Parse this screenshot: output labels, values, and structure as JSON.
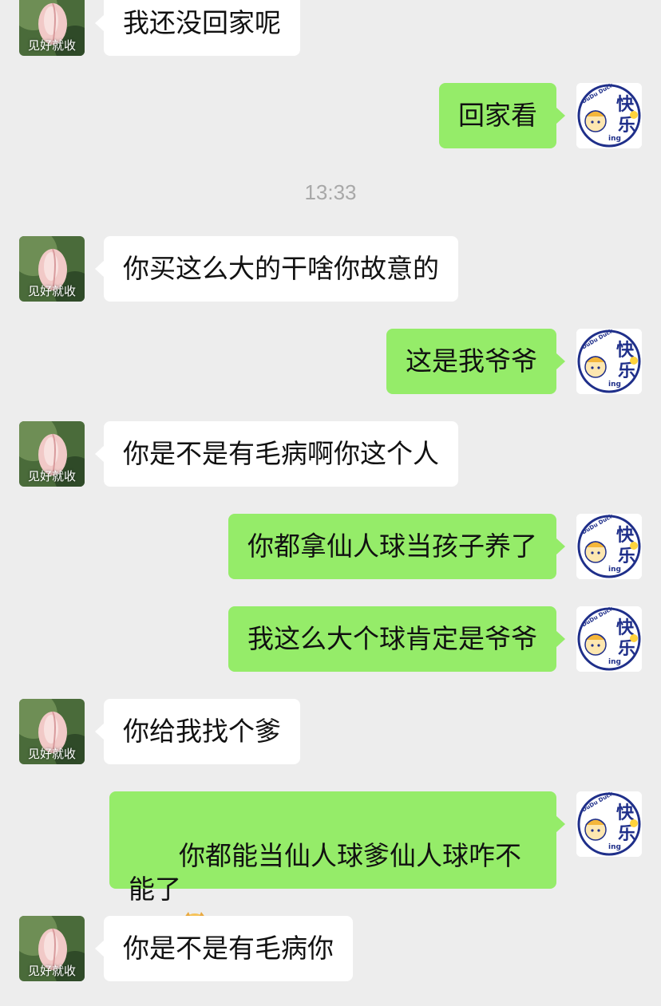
{
  "timestamp": "13:33",
  "avatars": {
    "other_label": "见好就收",
    "self_text_top": "快",
    "self_text_bottom": "乐",
    "self_small": "ing",
    "self_side": "DuDu Duck"
  },
  "colors": {
    "background": "#ededed",
    "incoming_bubble": "#ffffff",
    "outgoing_bubble": "#95ec69",
    "self_avatar_ring": "#1f2f8a",
    "timestamp_text": "#a8a8a8"
  },
  "messages": [
    {
      "side": "left",
      "text": "我还没回家呢"
    },
    {
      "side": "right",
      "text": "回家看"
    },
    {
      "side": "left",
      "text": "你买这么大的干啥你故意的"
    },
    {
      "side": "right",
      "text": "这是我爷爷"
    },
    {
      "side": "left",
      "text": "你是不是有毛病啊你这个人"
    },
    {
      "side": "right",
      "text": "你都拿仙人球当孩子养了"
    },
    {
      "side": "right",
      "text": "我这么大个球肯定是爷爷"
    },
    {
      "side": "left",
      "text": "你给我找个爹"
    },
    {
      "side": "right",
      "text": "你都能当仙人球爹仙人球咋不能了",
      "emoji": "doge-emoji"
    },
    {
      "side": "left",
      "text": "你是不是有毛病你"
    }
  ]
}
